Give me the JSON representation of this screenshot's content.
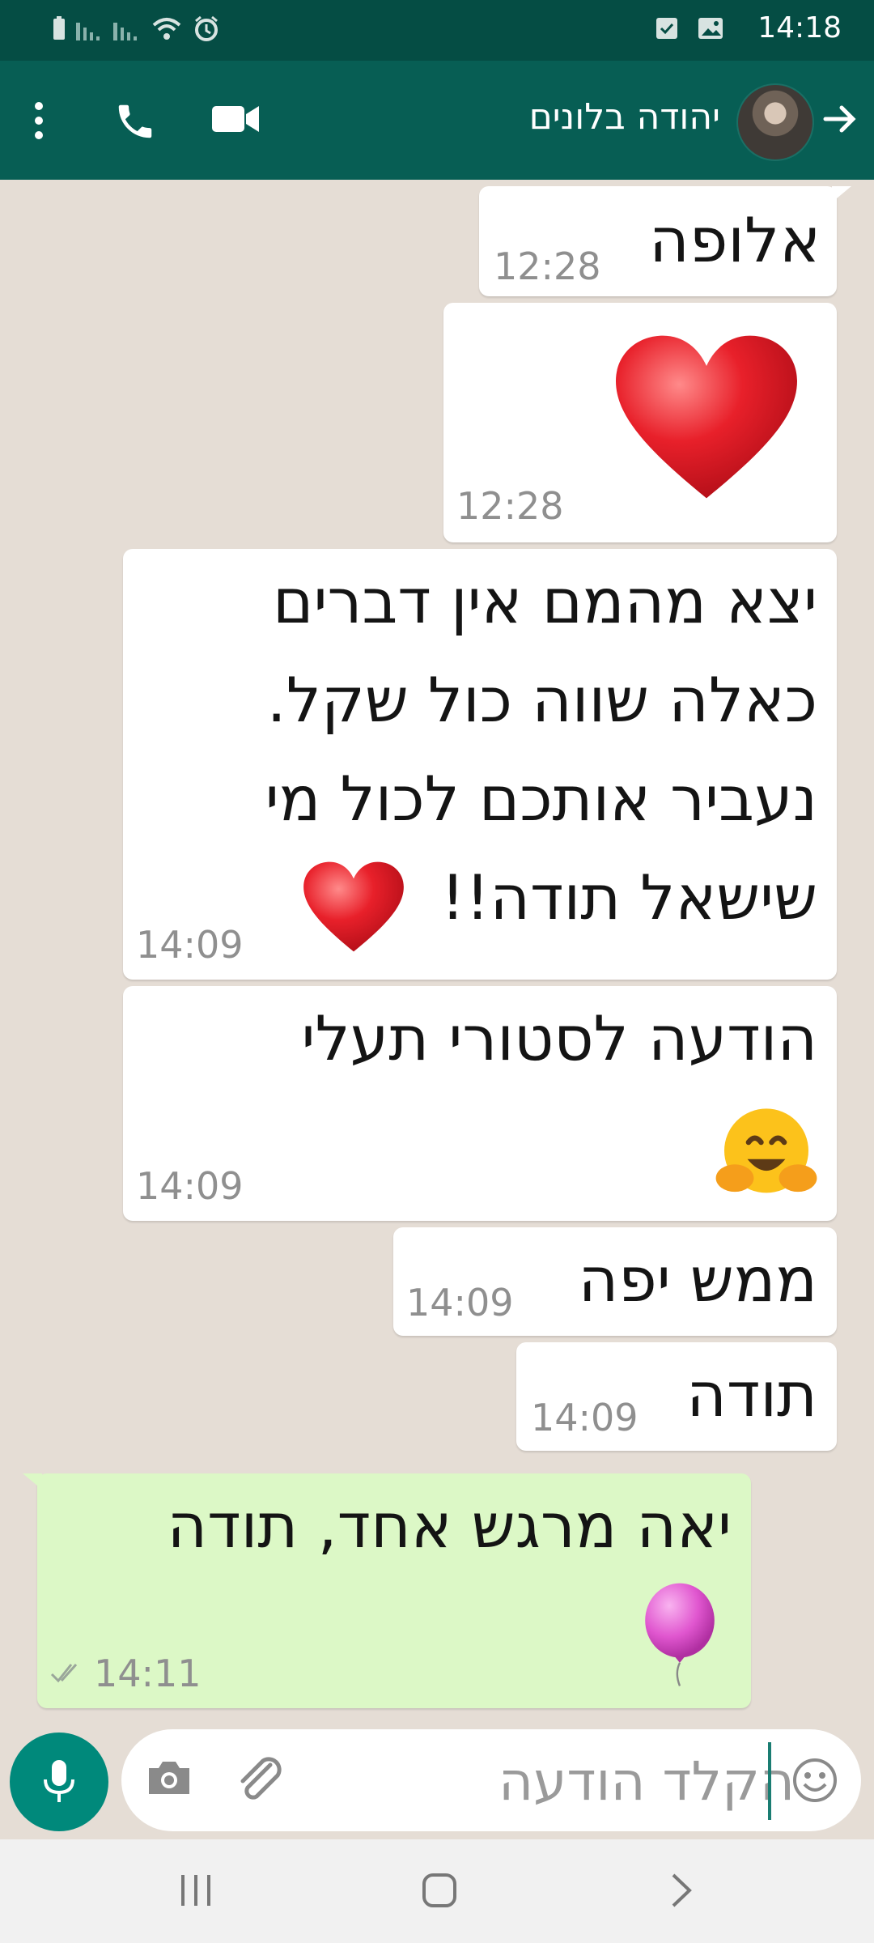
{
  "status_bar": {
    "time": "14:18",
    "left_icons": [
      "battery-icon",
      "signal-icon",
      "signal-icon",
      "wifi-icon",
      "alarm-icon"
    ],
    "right_icons": [
      "checkbox-notification-icon",
      "image-notification-icon"
    ]
  },
  "header": {
    "contact_name": "יהודה בלונים",
    "icons": [
      "back-arrow-icon",
      "avatar",
      "video-call-icon",
      "phone-icon",
      "more-vert-icon"
    ]
  },
  "messages": [
    {
      "direction": "incoming",
      "text": "אלופה",
      "time": "12:28"
    },
    {
      "direction": "incoming",
      "emoji": "red-heart",
      "time": "12:28"
    },
    {
      "direction": "incoming",
      "lines": [
        "יצא מהמם אין דברים",
        "כאלה שווה כול שקל.",
        "נעביר אותכם לכול מי",
        "שישאל תודה!!"
      ],
      "emoji": "red-heart",
      "time": "14:09"
    },
    {
      "direction": "incoming",
      "text": "הודעה לסטורי תעלי",
      "emoji": "hugging-face",
      "time": "14:09"
    },
    {
      "direction": "incoming",
      "text": "ממש יפה",
      "time": "14:09"
    },
    {
      "direction": "incoming",
      "text": "תודה",
      "time": "14:09"
    },
    {
      "direction": "outgoing",
      "text": "יאה מרגש אחד, תודה",
      "emoji": "balloon",
      "time": "14:11",
      "status": "delivered-double-check"
    }
  ],
  "composer": {
    "placeholder": "הקלד הודעה",
    "icons": [
      "mic-icon",
      "camera-icon",
      "paperclip-icon",
      "emoji-icon"
    ]
  },
  "navigation": {
    "items": [
      "recent-apps-icon",
      "home-icon",
      "back-icon"
    ]
  },
  "colors": {
    "header": "#075e54",
    "status_bar": "#054d44",
    "chat_background": "#e5ddd5",
    "outgoing_bubble": "#dcf8c6",
    "mic_button": "#00897b"
  }
}
